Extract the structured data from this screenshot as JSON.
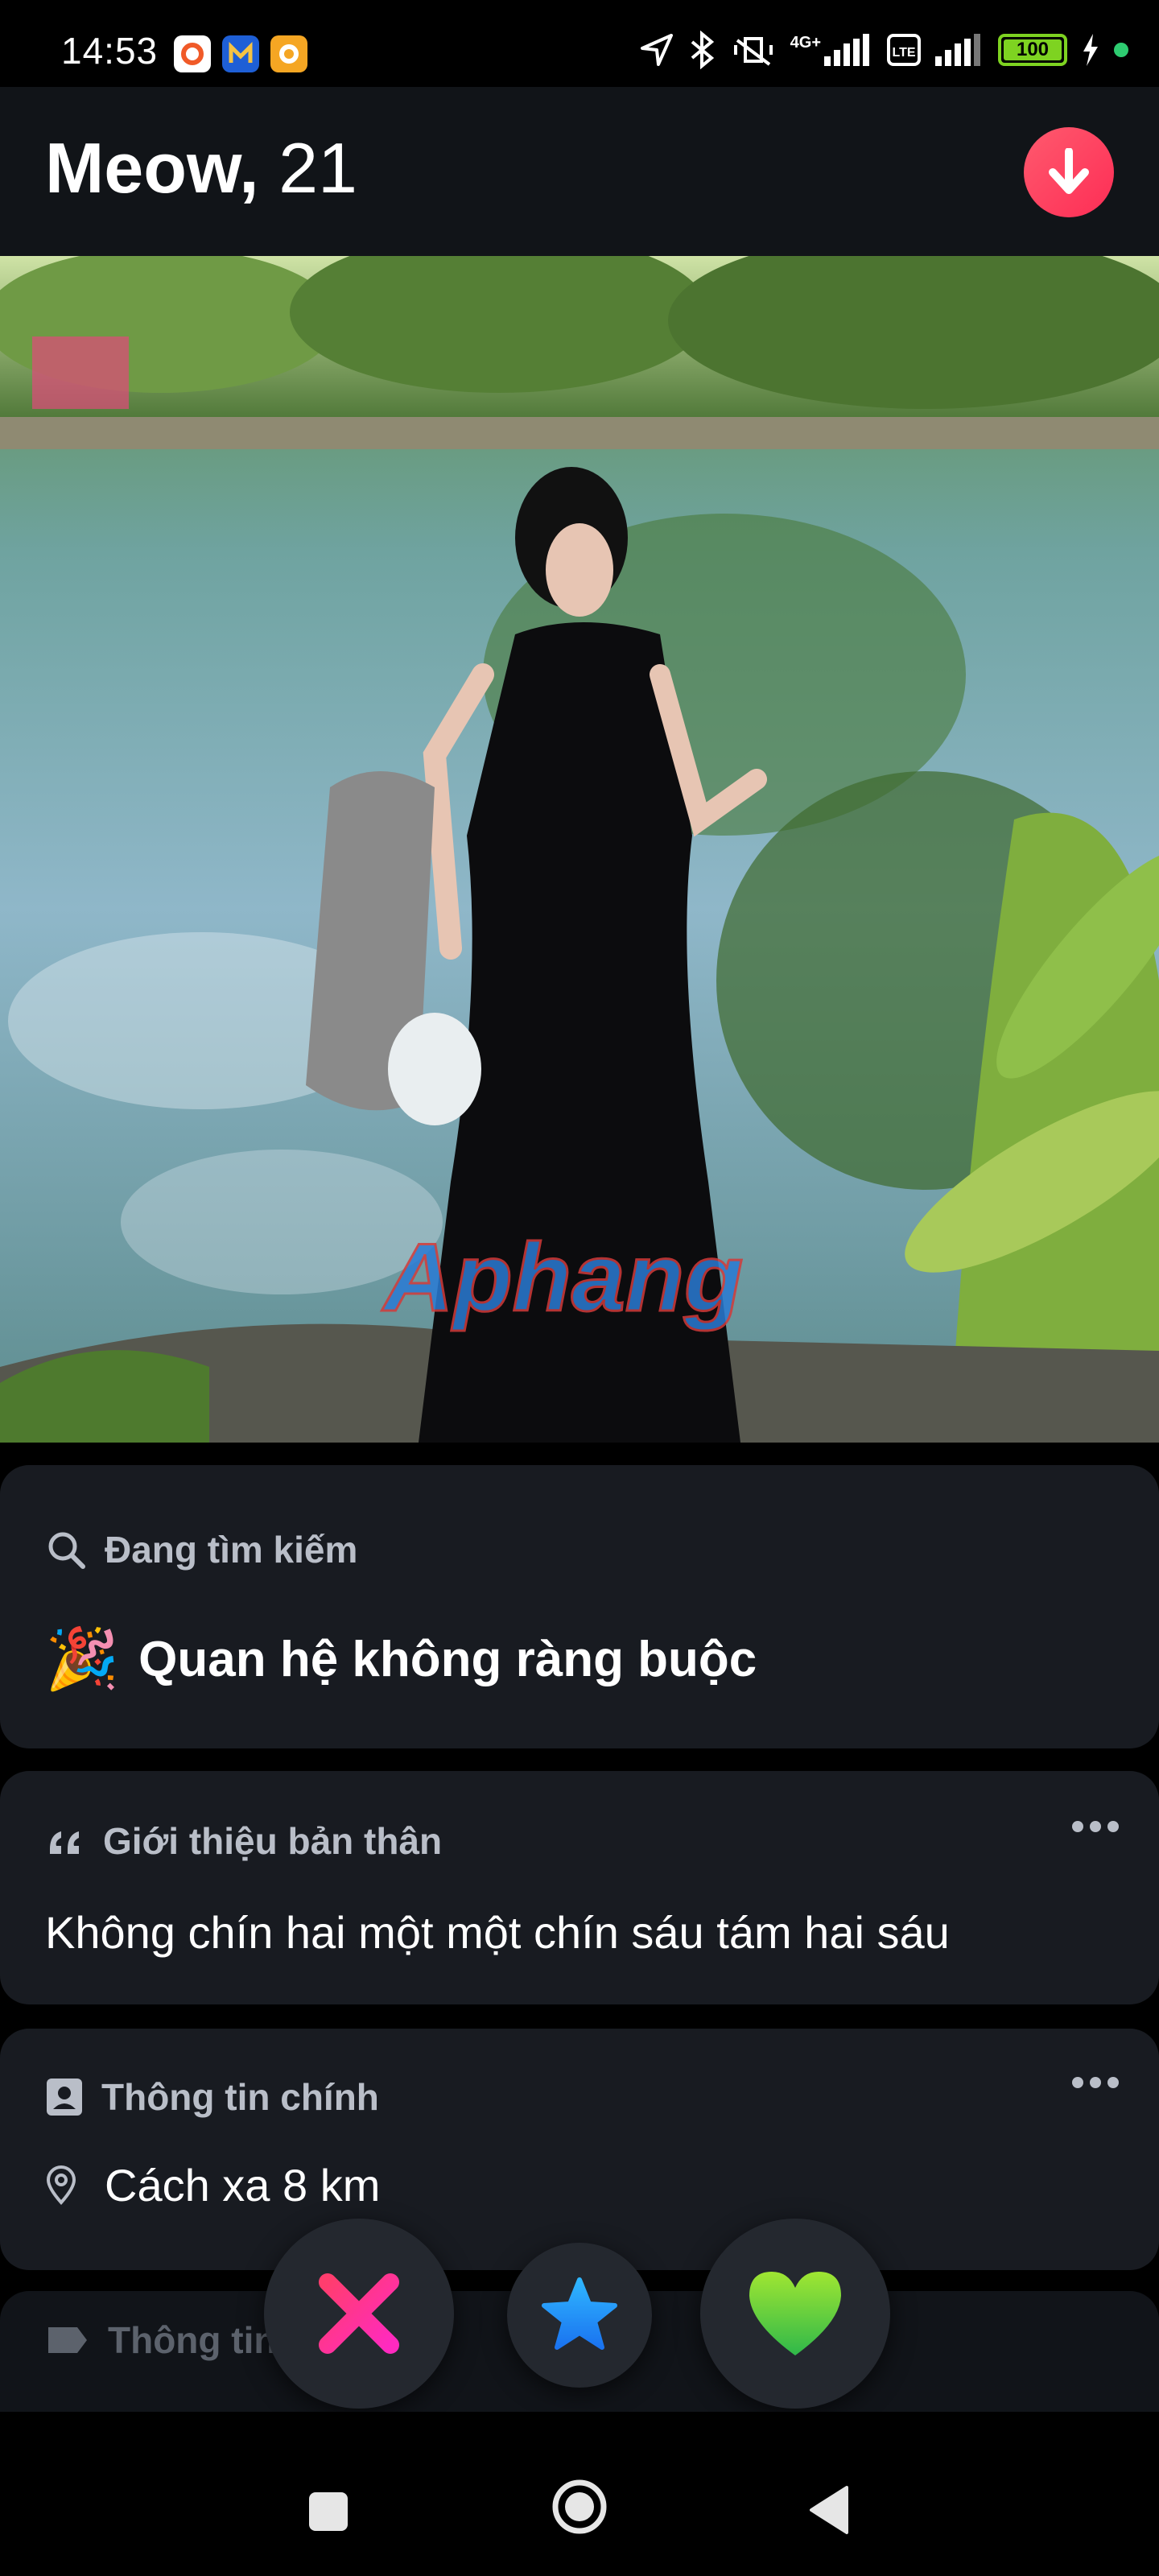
{
  "status_bar": {
    "time": "14:53",
    "network_label": "4G+",
    "battery": "100",
    "battery_fraction": 1.0
  },
  "profile": {
    "name": "Meow,",
    "age": "21"
  },
  "photo": {
    "watermark": "Aphang"
  },
  "looking_for": {
    "header": "Đang tìm kiếm",
    "emoji": "🎉",
    "value": "Quan hệ không ràng buộc"
  },
  "about": {
    "header": "Giới thiệu bản thân",
    "text": "Không chín hai một một chín sáu tám hai sáu"
  },
  "basics": {
    "header": "Thông tin chính",
    "distance": "Cách xa 8 km"
  },
  "partial_card": {
    "header": "Thông tin về tôi"
  },
  "colors": {
    "accent_red": "#fd2d55",
    "nope": "#ff2d8c",
    "super_like": "#1e90ff",
    "like": "#3cc43c",
    "card_bg": "#181b21"
  },
  "icons": {
    "collapse": "arrow-down-icon",
    "search": "search-icon",
    "quote": "quote-icon",
    "basics": "id-card-icon",
    "location": "location-pin-icon",
    "tag": "tag-icon",
    "nope": "x-icon",
    "super_like": "star-icon",
    "like": "heart-icon"
  }
}
